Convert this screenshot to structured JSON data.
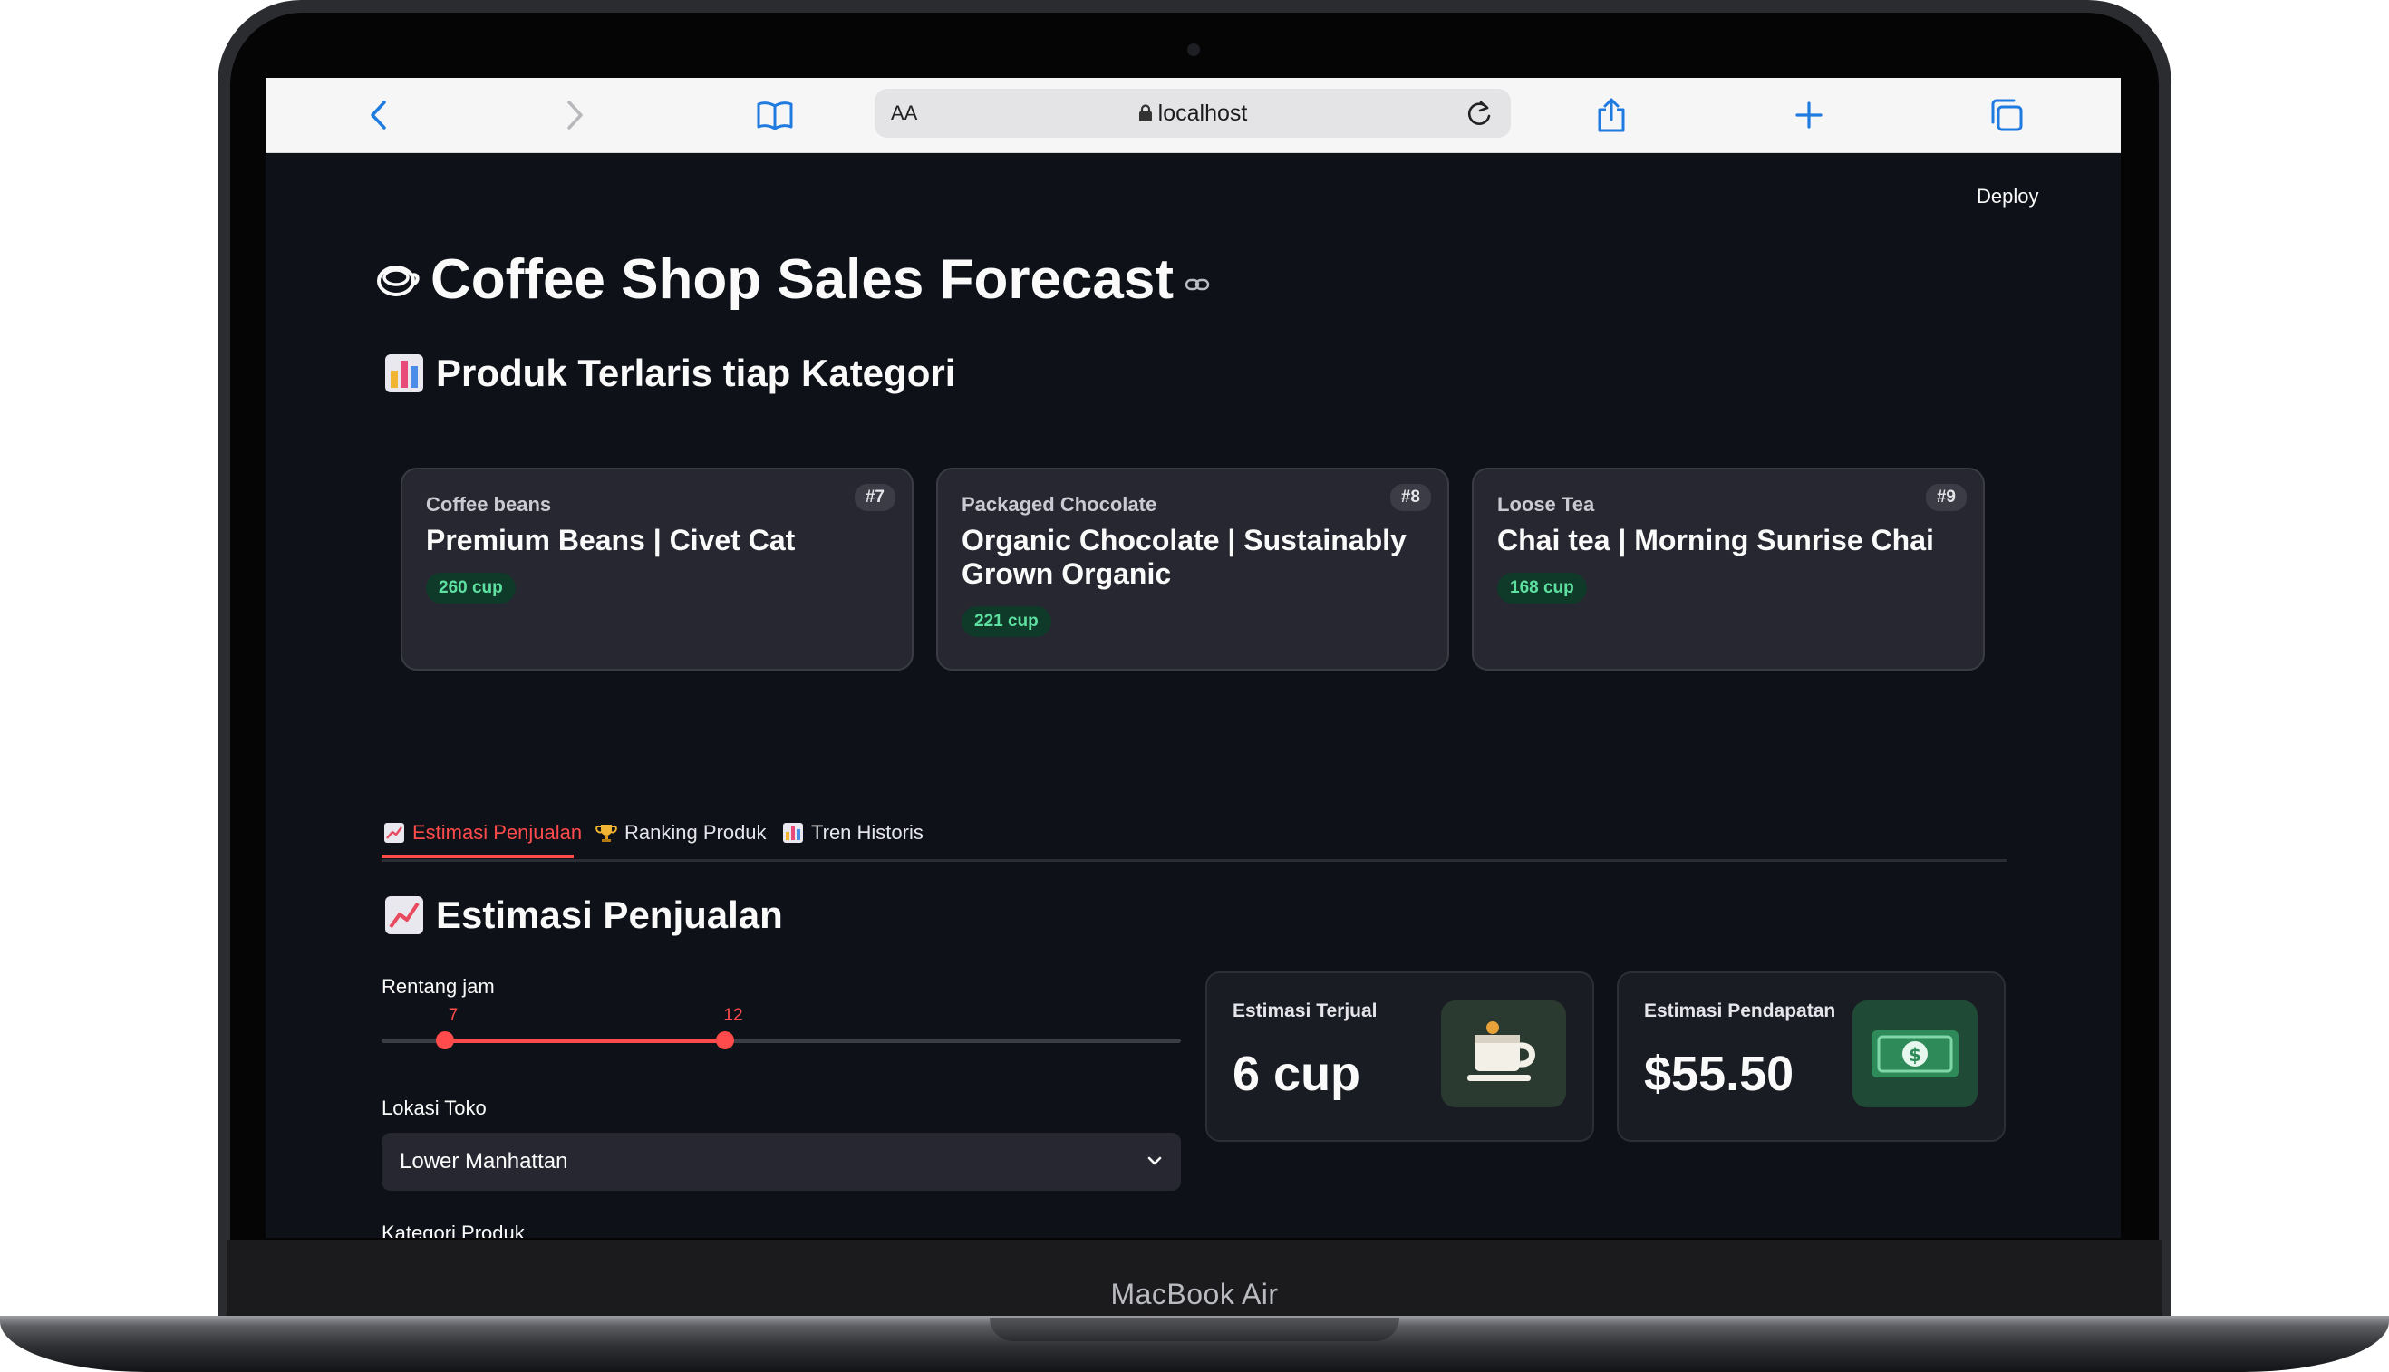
{
  "device": {
    "model_label": "MacBook Air"
  },
  "browser": {
    "text_size_label": "AA",
    "url": "localhost"
  },
  "app": {
    "deploy_label": "Deploy",
    "title": "Coffee Shop Sales Forecast",
    "section_best_sellers": "Produk Terlaris tiap Kategori",
    "products": [
      {
        "category": "Coffee beans",
        "rank": "#7",
        "name": "Premium Beans | Civet Cat",
        "qty": "260 cup"
      },
      {
        "category": "Packaged Chocolate",
        "rank": "#8",
        "name": "Organic Chocolate | Sustainably Grown Organic",
        "qty": "221 cup"
      },
      {
        "category": "Loose Tea",
        "rank": "#9",
        "name": "Chai tea | Morning Sunrise Chai",
        "qty": "168 cup"
      }
    ],
    "tabs": [
      {
        "label": "Estimasi Penjualan",
        "icon": "chart-increasing-icon",
        "active": true
      },
      {
        "label": "Ranking Produk",
        "icon": "trophy-icon",
        "active": false
      },
      {
        "label": "Tren Historis",
        "icon": "bar-chart-icon",
        "active": false
      }
    ],
    "estimasi": {
      "heading": "Estimasi Penjualan",
      "slider": {
        "label": "Rentang jam",
        "low": "7",
        "high": "12",
        "min": 0,
        "max": 23
      },
      "location": {
        "label": "Lokasi Toko",
        "value": "Lower Manhattan"
      },
      "category_label": "Kategori Produk",
      "metrics": [
        {
          "label": "Estimasi Terjual",
          "value": "6 cup",
          "icon": "coffee-cup-icon"
        },
        {
          "label": "Estimasi Pendapatan",
          "value": "$55.50",
          "icon": "money-icon"
        }
      ]
    },
    "colors": {
      "accent": "#ff4b4b",
      "background": "#0e1117",
      "card": "#262730",
      "pill_bg": "#0f3a2a",
      "pill_text": "#5ee0a0"
    }
  }
}
